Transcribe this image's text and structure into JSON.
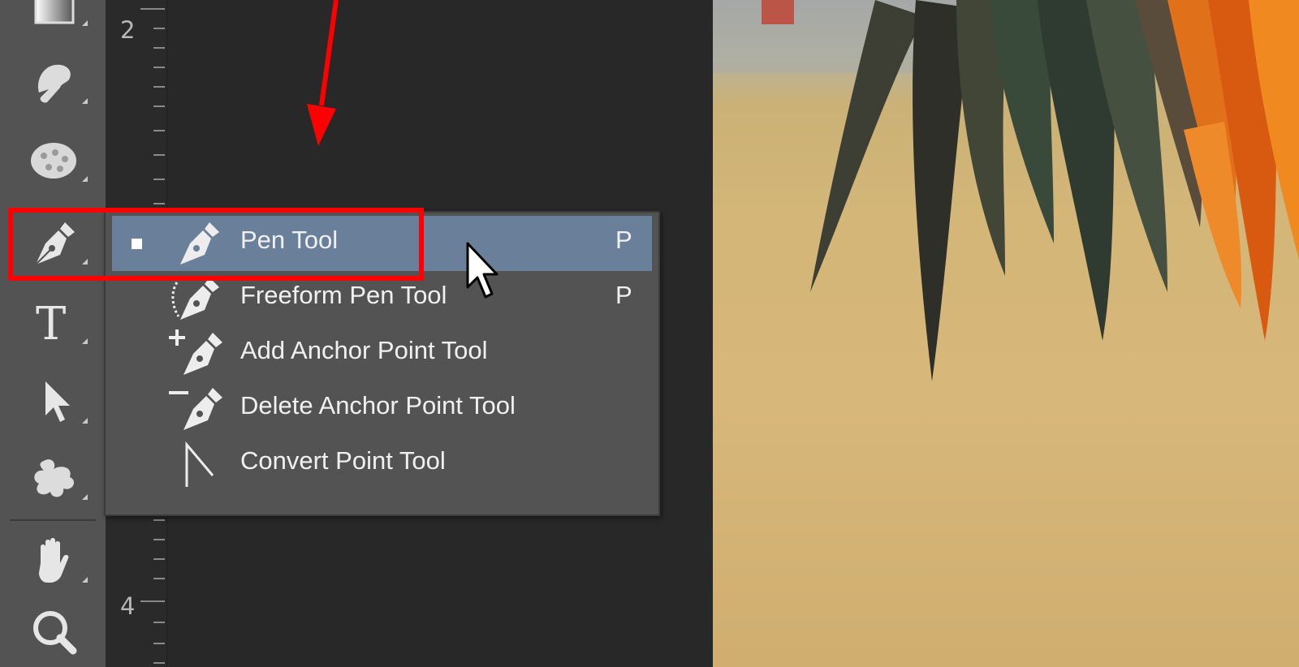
{
  "toolbar": {
    "tools": [
      {
        "name": "gradient-tool",
        "icon": "gradient-icon"
      },
      {
        "name": "smudge-tool",
        "icon": "finger-icon"
      },
      {
        "name": "sponge-tool",
        "icon": "sponge-icon"
      },
      {
        "name": "pen-tool",
        "icon": "pen-nib-icon",
        "active": true
      },
      {
        "name": "type-tool",
        "icon": "type-icon"
      },
      {
        "name": "path-selection-tool",
        "icon": "arrow-cursor-icon"
      },
      {
        "name": "custom-shape-tool",
        "icon": "shape-icon"
      },
      {
        "name": "hand-tool",
        "icon": "hand-icon"
      },
      {
        "name": "zoom-tool",
        "icon": "magnifier-icon"
      }
    ]
  },
  "ruler": {
    "labels": [
      "2",
      "4"
    ]
  },
  "flyout": {
    "items": [
      {
        "label": "Pen Tool",
        "shortcut": "P",
        "selected": true
      },
      {
        "label": "Freeform Pen Tool",
        "shortcut": "P",
        "selected": false
      },
      {
        "label": "Add Anchor Point Tool",
        "shortcut": "",
        "selected": false
      },
      {
        "label": "Delete Anchor Point Tool",
        "shortcut": "",
        "selected": false
      },
      {
        "label": "Convert Point Tool",
        "shortcut": "",
        "selected": false
      }
    ],
    "selected_color": "#6a7f9a"
  },
  "annotation": {
    "highlight_color": "#ff0000",
    "arrow_color": "#ff0000"
  }
}
